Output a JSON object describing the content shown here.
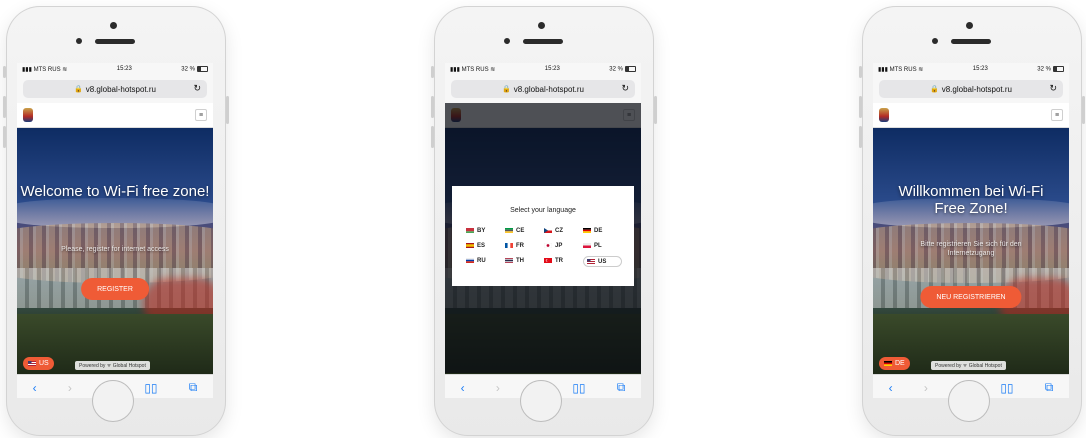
{
  "phones": [
    {
      "status": {
        "carrier": "MTS RUS",
        "time": "15:23",
        "battery": "32 %"
      },
      "url": "v8.global-hotspot.ru",
      "hero": {
        "title": "Welcome to Wi-Fi free zone!",
        "subtitle": "Please, register for internet access",
        "button": "REGISTER"
      },
      "language": "US",
      "powered": "Powered by",
      "powered_brand": "Global Hotspot"
    },
    {
      "status": {
        "carrier": "MTS RUS",
        "time": "15:23",
        "battery": "32 %"
      },
      "url": "v8.global-hotspot.ru",
      "modal": {
        "title": "Select your language",
        "languages": [
          "BY",
          "CE",
          "CZ",
          "DE",
          "ES",
          "FR",
          "JP",
          "PL",
          "RU",
          "TH",
          "TR",
          "US"
        ],
        "selected": "US"
      }
    },
    {
      "status": {
        "carrier": "MTS RUS",
        "time": "15:23",
        "battery": "32 %"
      },
      "url": "v8.global-hotspot.ru",
      "hero": {
        "title": "Willkommen bei Wi-Fi Free Zone!",
        "subtitle": "Bitte registrieren Sie sich für den Internetzugang",
        "button": "NEU REGISTRIEREN"
      },
      "language": "DE",
      "powered": "Powered by",
      "powered_brand": "Global Hotspot"
    }
  ],
  "colors": {
    "accent": "#ef5b36",
    "ios_blue": "#1a7cf5"
  },
  "icons": {
    "back": "chevron-left-icon",
    "forward": "chevron-right-icon",
    "share": "share-icon",
    "bookmarks": "book-icon",
    "tabs": "tabs-icon",
    "lock": "lock-icon",
    "reload": "reload-icon",
    "menu": "hamburger-icon"
  }
}
